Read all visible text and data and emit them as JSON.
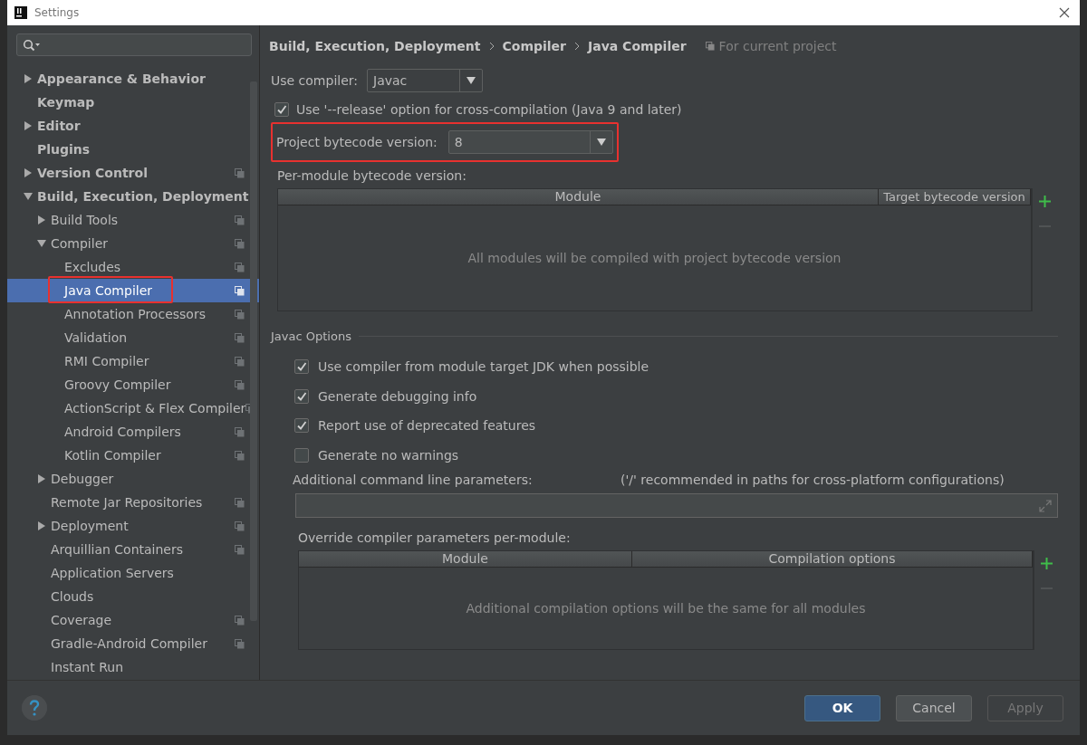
{
  "window": {
    "title": "Settings"
  },
  "sidebar": {
    "items": [
      {
        "label": "Appearance & Behavior",
        "selected": false,
        "expanded": false,
        "per_project": false
      },
      {
        "label": "Keymap",
        "selected": false,
        "per_project": false
      },
      {
        "label": "Editor",
        "selected": false,
        "expanded": false,
        "per_project": false
      },
      {
        "label": "Plugins",
        "selected": false,
        "per_project": false
      },
      {
        "label": "Version Control",
        "selected": false,
        "expanded": false,
        "per_project": true
      },
      {
        "label": "Build, Execution, Deployment",
        "selected": false,
        "expanded": true,
        "per_project": false,
        "children": [
          {
            "label": "Build Tools",
            "selected": false,
            "expanded": false,
            "per_project": true
          },
          {
            "label": "Compiler",
            "selected": false,
            "expanded": true,
            "per_project": true,
            "children": [
              {
                "label": "Excludes",
                "selected": false,
                "per_project": true
              },
              {
                "label": "Java Compiler",
                "selected": true,
                "per_project": true,
                "highlighted": true
              },
              {
                "label": "Annotation Processors",
                "selected": false,
                "per_project": true
              },
              {
                "label": "Validation",
                "selected": false,
                "per_project": true
              },
              {
                "label": "RMI Compiler",
                "selected": false,
                "per_project": true
              },
              {
                "label": "Groovy Compiler",
                "selected": false,
                "per_project": true
              },
              {
                "label": "ActionScript & Flex Compiler",
                "selected": false,
                "per_project": true
              },
              {
                "label": "Android Compilers",
                "selected": false,
                "per_project": true
              },
              {
                "label": "Kotlin Compiler",
                "selected": false,
                "per_project": true
              }
            ]
          },
          {
            "label": "Debugger",
            "selected": false,
            "expanded": false,
            "per_project": false
          },
          {
            "label": "Remote Jar Repositories",
            "selected": false,
            "per_project": true
          },
          {
            "label": "Deployment",
            "selected": false,
            "expanded": false,
            "per_project": true
          },
          {
            "label": "Arquillian Containers",
            "selected": false,
            "per_project": true
          },
          {
            "label": "Application Servers",
            "selected": false,
            "per_project": false
          },
          {
            "label": "Clouds",
            "selected": false,
            "per_project": false
          },
          {
            "label": "Coverage",
            "selected": false,
            "per_project": true
          },
          {
            "label": "Gradle-Android Compiler",
            "selected": false,
            "per_project": true
          },
          {
            "label": "Instant Run",
            "selected": false,
            "per_project": false
          }
        ]
      }
    ]
  },
  "breadcrumb": [
    "Build, Execution, Deployment",
    "Compiler",
    "Java Compiler"
  ],
  "scope_label": "For current project",
  "use_compiler": {
    "label": "Use compiler:",
    "value": "Javac"
  },
  "release_option": {
    "label": "Use '--release' option for cross-compilation (Java 9 and later)",
    "checked": true
  },
  "bytecode_version": {
    "label": "Project bytecode version:",
    "value": "8",
    "highlighted": true
  },
  "per_module": {
    "label": "Per-module bytecode version:",
    "columns": [
      "Module",
      "Target bytecode version"
    ],
    "empty_text": "All modules will be compiled with project bytecode version"
  },
  "javac_options": {
    "title": "Javac Options",
    "options": [
      {
        "label": "Use compiler from module target JDK when possible",
        "checked": true
      },
      {
        "label": "Generate debugging info",
        "checked": true
      },
      {
        "label": "Report use of deprecated features",
        "checked": true
      },
      {
        "label": "Generate no warnings",
        "checked": false
      }
    ],
    "params_label": "Additional command line parameters:",
    "params_hint": "('/' recommended in paths for cross-platform configurations)",
    "override_label": "Override compiler parameters per-module:",
    "override_columns": [
      "Module",
      "Compilation options"
    ],
    "override_empty_text": "Additional compilation options will be the same for all modules"
  },
  "buttons": [
    {
      "label": "OK",
      "kind": "default",
      "disabled": false
    },
    {
      "label": "Cancel",
      "kind": "normal",
      "disabled": false
    },
    {
      "label": "Apply",
      "kind": "normal",
      "disabled": true
    }
  ]
}
